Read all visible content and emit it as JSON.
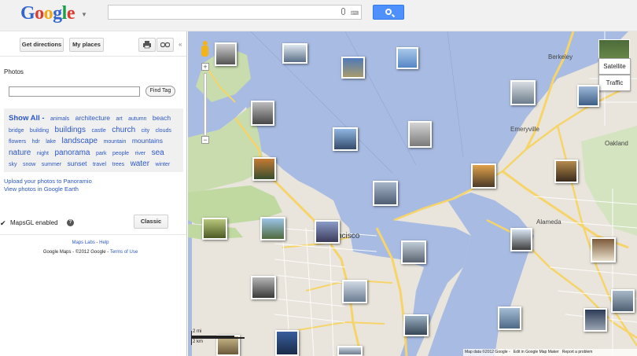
{
  "header": {
    "logo_letters": [
      {
        "ch": "G",
        "color": "#3366cc"
      },
      {
        "ch": "o",
        "color": "#dd3b30"
      },
      {
        "ch": "o",
        "color": "#f0a917"
      },
      {
        "ch": "g",
        "color": "#3366cc"
      },
      {
        "ch": "l",
        "color": "#1a9f48"
      },
      {
        "ch": "e",
        "color": "#dd3b30"
      }
    ],
    "search_value": "",
    "keyboard_glyph": "⌨"
  },
  "panel": {
    "get_directions": "Get directions",
    "my_places": "My places",
    "collapse_glyph": "«",
    "photos_title": "Photos",
    "find_tag": "Find Tag",
    "tags": [
      {
        "t": "Show All -",
        "s": "all"
      },
      {
        "t": "animals",
        "s": 1
      },
      {
        "t": "architecture",
        "s": 2
      },
      {
        "t": "art",
        "s": 1
      },
      {
        "t": "autumn",
        "s": 1
      },
      {
        "t": "beach",
        "s": 2
      },
      {
        "t": "bridge",
        "s": 1
      },
      {
        "t": "building",
        "s": 1
      },
      {
        "t": "buildings",
        "s": 3
      },
      {
        "t": "castle",
        "s": 1
      },
      {
        "t": "church",
        "s": 3
      },
      {
        "t": "city",
        "s": 1
      },
      {
        "t": "clouds",
        "s": 1
      },
      {
        "t": "flowers",
        "s": 1
      },
      {
        "t": "hdr",
        "s": 1
      },
      {
        "t": "lake",
        "s": 1
      },
      {
        "t": "landscape",
        "s": 3
      },
      {
        "t": "mountain",
        "s": 1
      },
      {
        "t": "mountains",
        "s": 2
      },
      {
        "t": "nature",
        "s": 3
      },
      {
        "t": "night",
        "s": 1
      },
      {
        "t": "panorama",
        "s": 3
      },
      {
        "t": "park",
        "s": 1
      },
      {
        "t": "people",
        "s": 1
      },
      {
        "t": "river",
        "s": 1
      },
      {
        "t": "sea",
        "s": 3
      },
      {
        "t": "sky",
        "s": 1
      },
      {
        "t": "snow",
        "s": 1
      },
      {
        "t": "summer",
        "s": 1
      },
      {
        "t": "sunset",
        "s": 2
      },
      {
        "t": "travel",
        "s": 1
      },
      {
        "t": "trees",
        "s": 1
      },
      {
        "t": "water",
        "s": 3
      },
      {
        "t": "winter",
        "s": 1
      }
    ],
    "upload_link": "Upload your photos to Panoramio",
    "earth_link": "View photos in Google Earth",
    "mapsgl_label": "MapsGL enabled",
    "help_glyph": "?",
    "classic_button": "Classic",
    "labs": "Maps Labs",
    "sep": " - ",
    "help": "Help",
    "copyright": "Google Maps - ©2012 Google - ",
    "terms": "Terms of Use"
  },
  "map": {
    "satellite": "Satellite",
    "traffic": "Traffic",
    "scale_mi": "2 mi",
    "scale_km": "2 km",
    "labels": {
      "berkeley": "Berkeley",
      "emeryville": "Emeryville",
      "francisco": "Francisco",
      "oakland": "Oakland",
      "alameda": "Alameda"
    },
    "footer": {
      "data": "Map data ©2012 Google -",
      "edit": "Edit in Google Map Maker",
      "report": "Report a problem"
    }
  }
}
